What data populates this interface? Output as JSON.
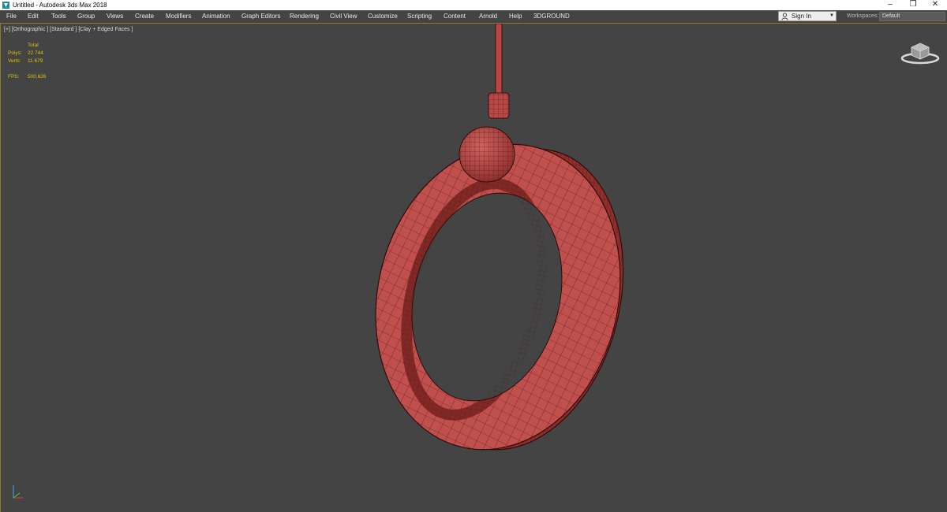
{
  "window": {
    "title": "Untitled - Autodesk 3ds Max 2018",
    "controls": {
      "minimize": "–",
      "restore": "❐",
      "close": "✕"
    }
  },
  "menubar": {
    "items": [
      "File",
      "Edit",
      "Tools",
      "Group",
      "Views",
      "Create",
      "Modifiers",
      "Animation",
      "Graph Editors",
      "Rendering",
      "Civil View",
      "Customize",
      "Scripting",
      "Content",
      "Arnold",
      "Help",
      "3DGROUND"
    ]
  },
  "account": {
    "sign_in": "Sign In"
  },
  "workspaces": {
    "label": "Workspaces:",
    "value": "Default"
  },
  "viewport": {
    "label": "[+] [Orthographic ] [Standard ] [Clay + Edged Faces ]",
    "stats": {
      "header": "Total",
      "polys_label": "Polys:",
      "polys_value": "22 744",
      "verts_label": "Verts:",
      "verts_value": "11 679",
      "fps_label": "FPS:",
      "fps_value": "500,626"
    }
  },
  "colors": {
    "viewport_bg": "#444444",
    "mesh_fill": "#c0504d",
    "wire": "#4a1412",
    "stats_text": "#e2c300"
  }
}
